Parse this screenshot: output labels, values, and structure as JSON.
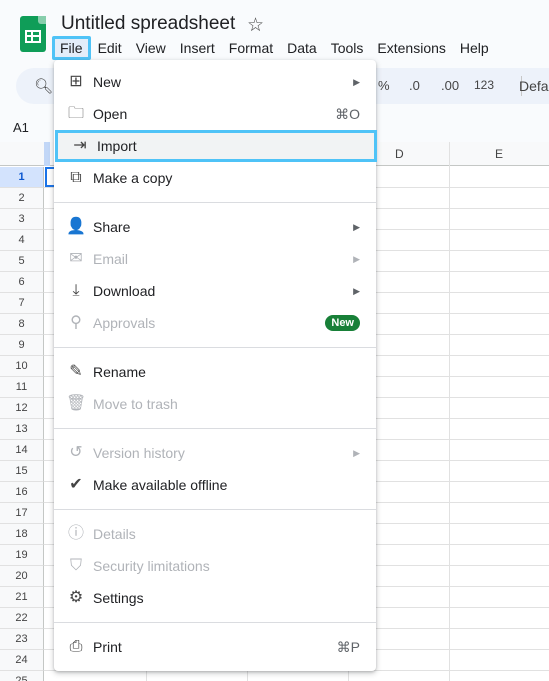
{
  "header": {
    "doc_title": "Untitled spreadsheet",
    "menus": [
      "File",
      "Edit",
      "View",
      "Insert",
      "Format",
      "Data",
      "Tools",
      "Extensions",
      "Help"
    ],
    "active_menu": "File"
  },
  "toolbar": {
    "percent": "%",
    "decrease_decimal": ".0",
    "increase_decimal": ".00",
    "number_format": "123",
    "font": "Defa"
  },
  "namebox": "A1",
  "grid": {
    "columns": [
      "D",
      "E"
    ],
    "rows": [
      "1",
      "2",
      "3",
      "4",
      "5",
      "6",
      "7",
      "8",
      "9",
      "10",
      "11",
      "12",
      "13",
      "14",
      "15",
      "16",
      "17",
      "18",
      "19",
      "20",
      "21",
      "22",
      "23",
      "24",
      "25"
    ]
  },
  "file_menu": {
    "groups": [
      [
        {
          "label": "New",
          "icon": "plus-box-icon",
          "submenu": true
        },
        {
          "label": "Open",
          "icon": "folder-icon",
          "shortcut": "⌘O"
        },
        {
          "label": "Import",
          "icon": "import-icon",
          "highlighted": true
        },
        {
          "label": "Make a copy",
          "icon": "copy-icon"
        }
      ],
      [
        {
          "label": "Share",
          "icon": "person-add-icon",
          "submenu": true
        },
        {
          "label": "Email",
          "icon": "email-icon",
          "submenu": true,
          "disabled": true
        },
        {
          "label": "Download",
          "icon": "download-icon",
          "submenu": true
        },
        {
          "label": "Approvals",
          "icon": "approvals-icon",
          "disabled": true,
          "badge": "New"
        }
      ],
      [
        {
          "label": "Rename",
          "icon": "pencil-icon"
        },
        {
          "label": "Move to trash",
          "icon": "trash-icon",
          "disabled": true
        }
      ],
      [
        {
          "label": "Version history",
          "icon": "history-icon",
          "submenu": true,
          "disabled": true
        },
        {
          "label": "Make available offline",
          "icon": "offline-check-icon"
        }
      ],
      [
        {
          "label": "Details",
          "icon": "info-icon",
          "disabled": true
        },
        {
          "label": "Security limitations",
          "icon": "shield-icon",
          "disabled": true
        },
        {
          "label": "Settings",
          "icon": "gear-icon"
        }
      ],
      [
        {
          "label": "Print",
          "icon": "printer-icon",
          "shortcut": "⌘P"
        }
      ]
    ]
  },
  "colors": {
    "highlight_outline": "#4fc3f7",
    "badge": "#188038",
    "selection": "#1a73e8"
  }
}
